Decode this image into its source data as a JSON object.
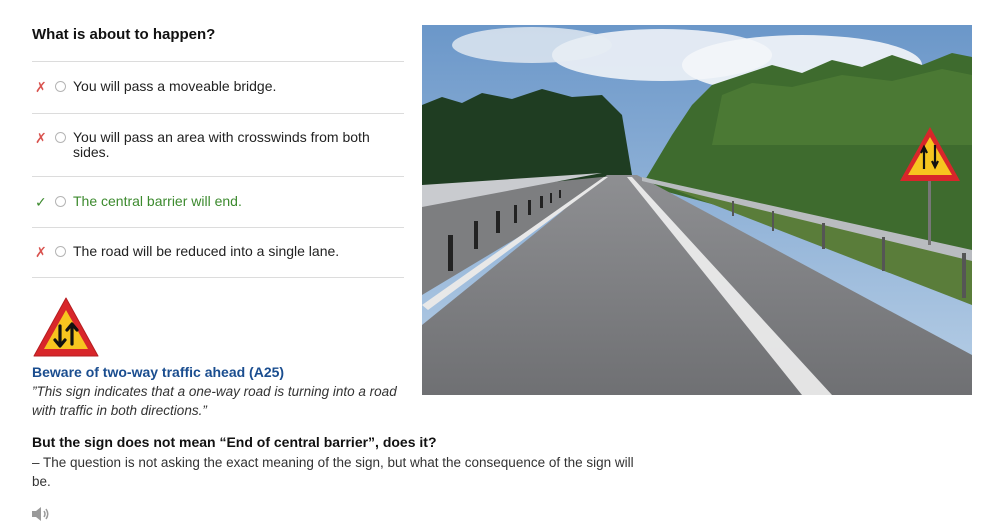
{
  "question": {
    "title": "What is about to happen?"
  },
  "answers": [
    {
      "mark": "✗",
      "status": "wrong",
      "text": "You will pass a moveable bridge."
    },
    {
      "mark": "✗",
      "status": "wrong",
      "text": "You will pass an area with crosswinds from both sides."
    },
    {
      "mark": "✓",
      "status": "correct",
      "text": "The central barrier will end."
    },
    {
      "mark": "✗",
      "status": "wrong",
      "text": "The road will be reduced into a single lane."
    }
  ],
  "explanation": {
    "sign_caption": "Beware of two-way traffic ahead (A25)",
    "sign_quote": "”This sign indicates that a one-way road is turning into a road with traffic in both directions.”",
    "followup_heading": "But the sign does not mean “End of central barrier”, does it?",
    "followup_text": "– The question is not asking the exact meaning of the sign, but what the consequence of the sign will be."
  },
  "colors": {
    "wrong": "#d9534f",
    "correct": "#3c8a2e",
    "caption": "#1a4d8f",
    "sign_border": "#d8262a",
    "sign_fill": "#f7c51f"
  },
  "icons": {
    "sign": "two-way-traffic-warning-sign-icon",
    "audio": "speaker-icon"
  }
}
